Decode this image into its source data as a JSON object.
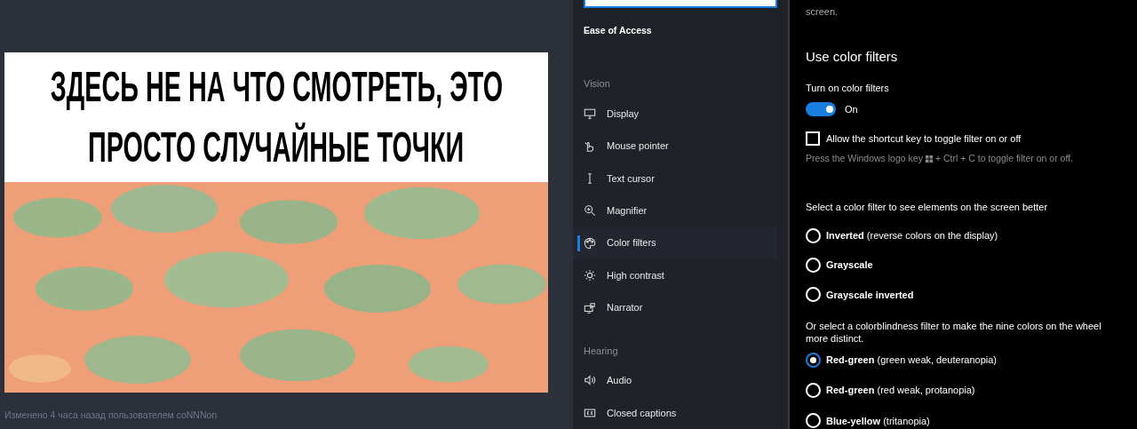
{
  "viewer": {
    "caption": [
      "ЗДЕСЬ НЕ НА ЧТО СМОТРЕТЬ, ЭТО",
      "ПРОСТО СЛУЧАЙНЫЕ ТОЧКИ"
    ],
    "footer": "Изменено 4 часа назад пользователем coNNNon"
  },
  "sidebar": {
    "title": "Ease of Access",
    "groups": [
      {
        "heading": "Vision",
        "items": [
          {
            "label": "Display",
            "selected": false
          },
          {
            "label": "Mouse pointer",
            "selected": false
          },
          {
            "label": "Text cursor",
            "selected": false
          },
          {
            "label": "Magnifier",
            "selected": false
          },
          {
            "label": "Color filters",
            "selected": true
          },
          {
            "label": "High contrast",
            "selected": false
          },
          {
            "label": "Narrator",
            "selected": false
          }
        ]
      },
      {
        "heading": "Hearing",
        "items": [
          {
            "label": "Audio",
            "selected": false
          },
          {
            "label": "Closed captions",
            "selected": false
          }
        ]
      }
    ]
  },
  "content": {
    "intro": "screen.",
    "heading": "Use color filters",
    "toggle": {
      "label": "Turn on color filters",
      "on": true,
      "state_text": "On"
    },
    "shortcut": {
      "label": "Allow the shortcut key to toggle filter on or off",
      "checked": false,
      "hint_before": "Press the Windows logo key",
      "hint_after": "+ Ctrl + C to toggle filter on or off."
    },
    "filters_label": "Select a color filter to see elements on the screen better",
    "filters": [
      {
        "name": "Inverted",
        "detail": "(reverse colors on the display)",
        "selected": false
      },
      {
        "name": "Grayscale",
        "selected": false
      },
      {
        "name": "Grayscale inverted",
        "selected": false
      }
    ],
    "colorblind_label": "Or select a colorblindness filter to make the nine colors on the wheel more distinct.",
    "colorblind": [
      {
        "name": "Red-green",
        "detail": "(green weak, deuteranopia)",
        "selected": true
      },
      {
        "name": "Red-green",
        "detail": "(red weak, protanopia)",
        "selected": false
      },
      {
        "name": "Blue-yellow",
        "detail": "(tritanopia)",
        "selected": false
      }
    ]
  }
}
